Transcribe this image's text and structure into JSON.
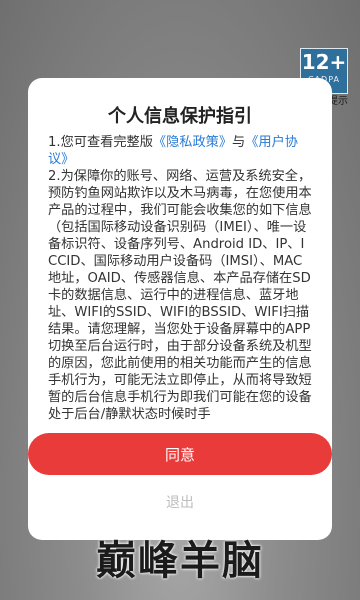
{
  "age_rating": {
    "number": "12+",
    "sub": "CADPA",
    "tip": "提示"
  },
  "dialog": {
    "title": "个人信息保护指引",
    "item1_prefix": "1.您可查看完整版",
    "privacy_link": "《隐私政策》",
    "item1_and": "与",
    "agreement_link": "《用户协议》",
    "item2": "2.为保障你的账号、网络、运营及系统安全，预防钓鱼网站欺诈以及木马病毒，在您使用本产品的过程中，我们可能会收集您的如下信息（包括国际移动设备识别码（IMEI）、唯一设备标识符、设备序列号、Android ID、IP、ICCID、国际移动用户设备码（IMSI）、MAC地址，OAID、传感器信息、本产品存储在SD卡的数据信息、运行中的进程信息、蓝牙地址、WIFI的SSID、WIFI的BSSID、WIFI扫描结果。请您理解，当您处于设备屏幕中的APP切换至后台运行时，由于部分设备系统及机型的原因，您此前使用的相关功能而产生的信息手机行为，可能无法立即停止，从而将导致短暂的后台信息手机行为即我们可能在您的设备处于后台/静默状态时候时手"
  },
  "buttons": {
    "agree": "同意",
    "exit": "退出"
  },
  "game_title": "巅峰羊脑",
  "colors": {
    "accent": "#ea3b3b",
    "link": "#2a7bd5"
  }
}
